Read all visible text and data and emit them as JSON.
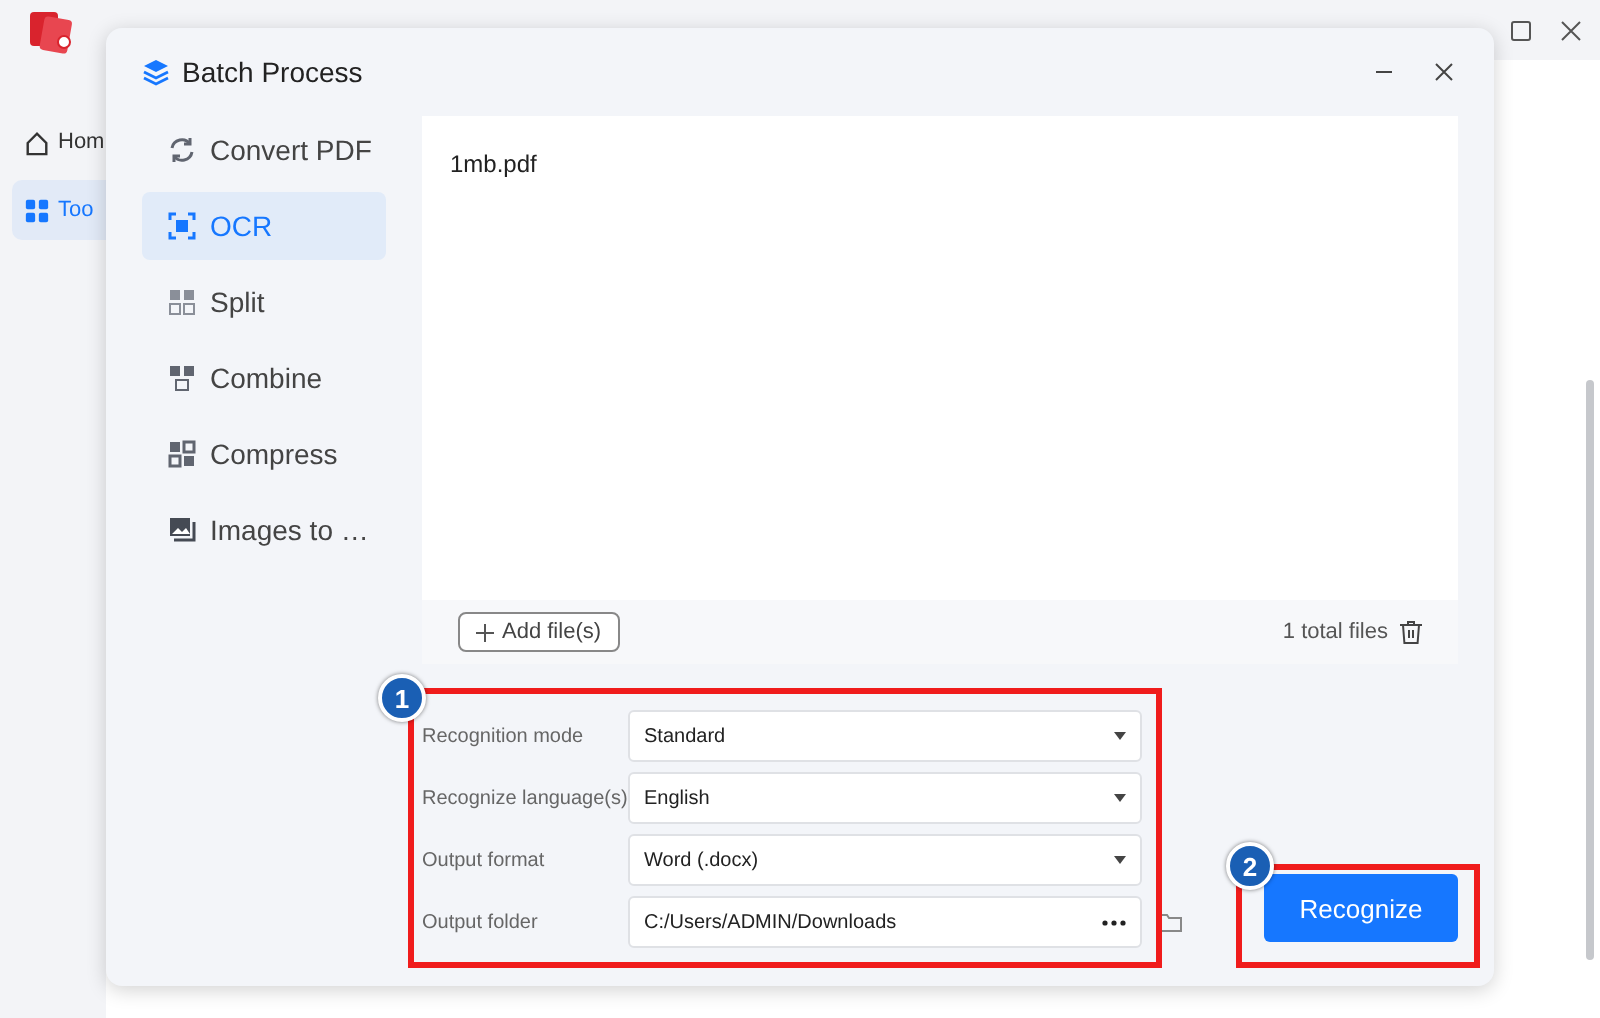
{
  "app": {
    "sidebar": [
      {
        "label": "Hom",
        "selected": false
      },
      {
        "label": "Too",
        "selected": true
      }
    ]
  },
  "dialog": {
    "title": "Batch Process",
    "nav": [
      {
        "label": "Convert PDF",
        "selected": false
      },
      {
        "label": "OCR",
        "selected": true
      },
      {
        "label": "Split",
        "selected": false
      },
      {
        "label": "Combine",
        "selected": false
      },
      {
        "label": "Compress",
        "selected": false
      },
      {
        "label": "Images to …",
        "selected": false
      }
    ],
    "files": [
      {
        "name": "1mb.pdf"
      }
    ],
    "add_button": "Add file(s)",
    "total_files": "1 total files",
    "form": [
      {
        "label": "Recognition mode",
        "value": "Standard",
        "kind": "select"
      },
      {
        "label": "Recognize language(s)",
        "value": "English",
        "kind": "select"
      },
      {
        "label": "Output format",
        "value": "Word (.docx)",
        "kind": "select"
      },
      {
        "label": "Output folder",
        "value": "C:/Users/ADMIN/Downloads",
        "kind": "path"
      }
    ],
    "action_button": "Recognize",
    "annotations": [
      {
        "number": "1"
      },
      {
        "number": "2"
      }
    ]
  }
}
